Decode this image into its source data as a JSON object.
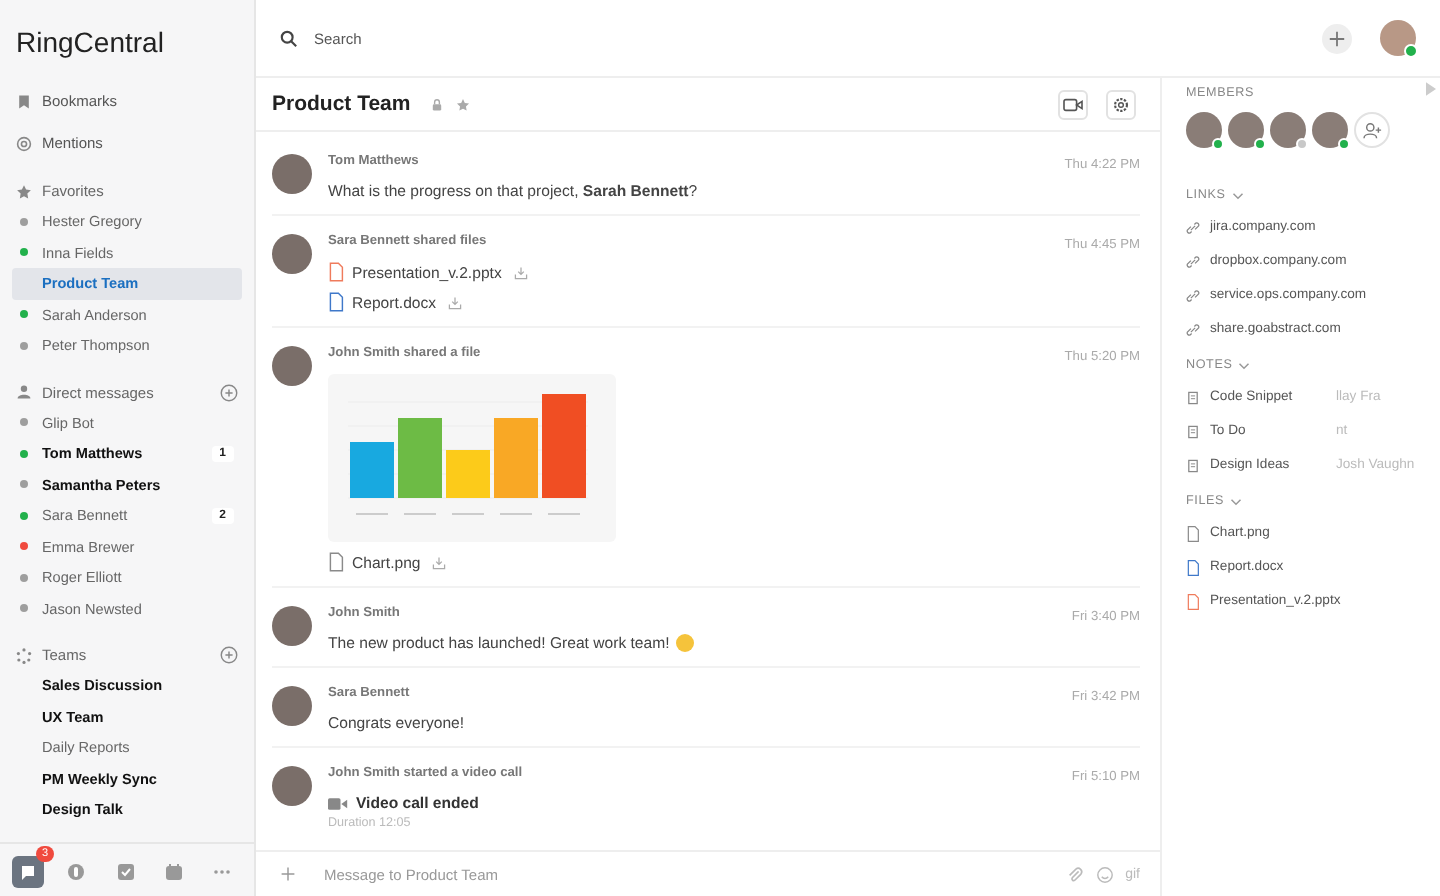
{
  "app_title": "RingCentral",
  "search": {
    "placeholder": "Search"
  },
  "nav": [
    {
      "label": "Bookmarks"
    },
    {
      "label": "Mentions"
    }
  ],
  "sections": [
    {
      "title": "Favorites",
      "add": false,
      "items": [
        {
          "label": "Hester Gregory",
          "color": "#9e9e9e",
          "unread": false,
          "selected": false
        },
        {
          "label": "Inna Fields",
          "color": "#22b14c",
          "unread": false,
          "selected": false
        },
        {
          "label": "Product Team",
          "unread": false,
          "selected": true
        },
        {
          "label": "Sarah Anderson",
          "color": "#22b14c",
          "unread": false,
          "selected": false
        },
        {
          "label": "Peter Thompson",
          "color": "#9e9e9e",
          "unread": false,
          "selected": false
        }
      ]
    },
    {
      "title": "Direct messages",
      "add": true,
      "items": [
        {
          "label": "Glip Bot",
          "color": "#9e9e9e",
          "unread": false,
          "selected": false
        },
        {
          "label": "Tom Matthews",
          "color": "#22b14c",
          "unread": true,
          "selected": false,
          "count": "1"
        },
        {
          "label": "Samantha Peters",
          "color": "#9e9e9e",
          "unread": true,
          "selected": false
        },
        {
          "label": "Sara Bennett",
          "color": "#22b14c",
          "unread": false,
          "selected": false,
          "count": "2"
        },
        {
          "label": "Emma Brewer",
          "color": "#f04a3e",
          "unread": false,
          "selected": false
        },
        {
          "label": "Roger Elliott",
          "color": "#9e9e9e",
          "unread": false,
          "selected": false
        },
        {
          "label": "Jason Newsted",
          "color": "#9e9e9e",
          "unread": false,
          "selected": false
        }
      ]
    },
    {
      "title": "Teams",
      "add": true,
      "items": [
        {
          "label": "Sales Discussion",
          "unread": true,
          "selected": false
        },
        {
          "label": "UX Team",
          "unread": true,
          "selected": false
        },
        {
          "label": "Daily Reports",
          "unread": false,
          "selected": false
        },
        {
          "label": "PM Weekly Sync",
          "unread": true,
          "selected": false
        },
        {
          "label": "Design Talk",
          "unread": true,
          "selected": false
        }
      ]
    }
  ],
  "toolbar": [
    {
      "selected": true,
      "badge": "3"
    },
    {
      "selected": false
    },
    {
      "selected": false
    },
    {
      "selected": false
    },
    {
      "selected": false
    }
  ],
  "conversation": {
    "title": "Product Team",
    "private": true,
    "favorite": true
  },
  "messages": [
    {
      "kind": "text",
      "author": "Tom Matthews",
      "time": "Thu 4:22 PM",
      "text": "What is the progress on that project, **Sarah Bennett**?",
      "emoji": false
    },
    {
      "kind": "files",
      "author": "Sara Bennett shared files",
      "time": "Thu 4:45 PM",
      "files": [
        {
          "name": "Presentation_v.2.pptx",
          "kind": "presentation"
        },
        {
          "name": "Report.docx",
          "kind": "document"
        }
      ]
    },
    {
      "kind": "image",
      "author": "John Smith shared a file",
      "time": "Thu 5:20 PM",
      "files": [
        {
          "name": "Chart.png",
          "kind": "image"
        }
      ]
    },
    {
      "kind": "text",
      "author": "John Smith",
      "time": "Fri 3:40 PM",
      "text": "The new product has launched! Great work team!",
      "emoji": true
    },
    {
      "kind": "text",
      "author": "Sara Bennett",
      "time": "Fri 3:42 PM",
      "text": "Congrats everyone!",
      "emoji": false
    },
    {
      "kind": "video_call",
      "author": "John Smith started a video call",
      "time": "Fri 5:10 PM",
      "title": "Video call ended",
      "detail": "Duration 12:05"
    }
  ],
  "composer": {
    "placeholder": "Message to Product Team",
    "gif": "gif"
  },
  "details": {
    "members_title": "MEMBERS",
    "members": [
      {
        "color": "#22b14c"
      },
      {
        "color": "#22b14c"
      },
      {
        "color": "#c8c8c8"
      },
      {
        "color": "#22b14c"
      }
    ],
    "links_title": "LINKS",
    "links": [
      "jira.company.com",
      "dropbox.company.com",
      "service.ops.company.com",
      "share.goabstract.com"
    ],
    "notes_title": "NOTES",
    "notes": [
      {
        "title": "Code Snippet",
        "author": "llay Fra"
      },
      {
        "title": "To Do",
        "author": "nt"
      },
      {
        "title": "Design Ideas",
        "author": "Josh Vaughn"
      }
    ],
    "files_title": "FILES",
    "files": [
      {
        "name": "Chart.png",
        "kind": "image"
      },
      {
        "name": "Report.docx",
        "kind": "document"
      },
      {
        "name": "Presentation_v.2.pptx",
        "kind": "presentation"
      }
    ]
  }
}
